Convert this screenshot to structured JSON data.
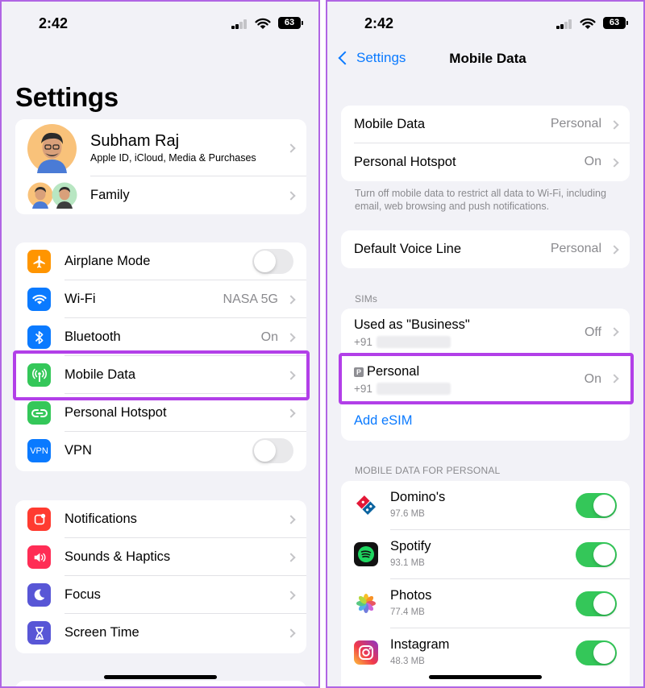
{
  "status": {
    "time": "2:42",
    "battery": "63"
  },
  "settings": {
    "title": "Settings",
    "profile": {
      "name": "Subham Raj",
      "subtitle": "Apple ID, iCloud, Media & Purchases",
      "family": "Family"
    },
    "group1": [
      {
        "label": "Airplane Mode",
        "type": "toggle",
        "on": false,
        "icon": "airplane-icon",
        "color": "#ff9500"
      },
      {
        "label": "Wi-Fi",
        "value": "NASA 5G",
        "icon": "wifi-icon",
        "color": "#0a7aff"
      },
      {
        "label": "Bluetooth",
        "value": "On",
        "icon": "bluetooth-icon",
        "color": "#0a7aff"
      },
      {
        "label": "Mobile Data",
        "icon": "antenna-icon",
        "color": "#34c759"
      },
      {
        "label": "Personal Hotspot",
        "icon": "hotspot-icon",
        "color": "#34c759"
      },
      {
        "label": "VPN",
        "type": "toggle",
        "on": false,
        "icon": "vpn-icon",
        "color": "#0a7aff"
      }
    ],
    "group2": [
      {
        "label": "Notifications",
        "icon": "bell-icon",
        "color": "#ff3b30"
      },
      {
        "label": "Sounds & Haptics",
        "icon": "speaker-icon",
        "color": "#ff2d55"
      },
      {
        "label": "Focus",
        "icon": "moon-icon",
        "color": "#5856d6"
      },
      {
        "label": "Screen Time",
        "icon": "hourglass-icon",
        "color": "#5856d6"
      }
    ]
  },
  "mobile_data": {
    "back_label": "Settings",
    "title": "Mobile Data",
    "rows": [
      {
        "label": "Mobile Data",
        "value": "Personal"
      },
      {
        "label": "Personal Hotspot",
        "value": "On"
      }
    ],
    "footnote": "Turn off mobile data to restrict all data to Wi-Fi, including email, web browsing and push notifications.",
    "voice": {
      "label": "Default Voice Line",
      "value": "Personal"
    },
    "sims_header": "SIMs",
    "sims": [
      {
        "name": "Used as \"Business\"",
        "number_prefix": "+91",
        "value": "Off"
      },
      {
        "name": "Personal",
        "badge": "P",
        "number_prefix": "+91",
        "value": "On"
      }
    ],
    "add_esim": "Add eSIM",
    "apps_header": "MOBILE DATA FOR PERSONAL",
    "apps": [
      {
        "name": "Domino's",
        "size": "97.6 MB",
        "on": true,
        "icon": "dominos-icon"
      },
      {
        "name": "Spotify",
        "size": "93.1 MB",
        "on": true,
        "icon": "spotify-icon"
      },
      {
        "name": "Photos",
        "size": "77.4 MB",
        "on": true,
        "icon": "photos-icon"
      },
      {
        "name": "Instagram",
        "size": "48.3 MB",
        "on": true,
        "icon": "instagram-icon"
      }
    ]
  }
}
